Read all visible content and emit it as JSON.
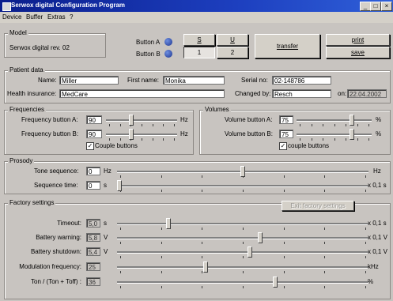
{
  "window": {
    "title": "Serwox digital Configuration Program",
    "min": "_",
    "max": "□",
    "close": "×"
  },
  "menu": [
    "Device",
    "Buffer",
    "Extras",
    "?"
  ],
  "model": {
    "title": "Model",
    "value": "Serwox digital rev. 02"
  },
  "buttons": {
    "a_label": "Button A",
    "b_label": "Button B",
    "s": "S",
    "u": "U",
    "one": "1",
    "two": "2",
    "transfer": "transfer",
    "print": "print",
    "save": "save"
  },
  "patient": {
    "title": "Patient data",
    "name_label": "Name:",
    "name": "Miller",
    "first_label": "First name:",
    "first": "Monika",
    "serial_label": "Serial no:",
    "serial": "02-148786",
    "insurance_label": "Health insurance:",
    "insurance": "MedCare",
    "changed_label": "Changed by:",
    "changed": "Resch",
    "on_label": "on:",
    "on": "22.04.2002"
  },
  "frequencies": {
    "title": "Frequencies",
    "a_label": "Frequency button A:",
    "a_value": "90",
    "a_unit": "Hz",
    "a_level": 0.34,
    "b_label": "Frequency button B:",
    "b_value": "90",
    "b_unit": "Hz",
    "b_level": 0.34,
    "couple": "Couple buttons"
  },
  "volumes": {
    "title": "Volumes",
    "a_label": "Volume button A:",
    "a_value": "75",
    "a_unit": "%",
    "a_level": 0.75,
    "b_label": "Volume button B:",
    "b_value": "75",
    "b_unit": "%",
    "b_level": 0.75,
    "couple": "couple buttons"
  },
  "prosody": {
    "title": "Prosody",
    "tone_label": "Tone sequence:",
    "tone_value": "0",
    "tone_unit": "Hz",
    "tone_unit_right": "Hz",
    "tone_level": 0.5,
    "seq_label": "Sequence time:",
    "seq_value": "0",
    "seq_unit": "s",
    "seq_unit_right": "x 0,1 s",
    "seq_level": 0.0
  },
  "factory": {
    "title": "Factory settings",
    "exit": "Exit factory settings",
    "rows": [
      {
        "label": "Timeout:",
        "value": "5,0",
        "unit": "s",
        "right": "x 0,1 s",
        "level": 0.2
      },
      {
        "label": "Battery warning:",
        "value": "5,8",
        "unit": "V",
        "right": "x 0,1 V",
        "level": 0.57
      },
      {
        "label": "Battery shutdown:",
        "value": "5,4",
        "unit": "V",
        "right": "x 0,1 V",
        "level": 0.53
      },
      {
        "label": "Modulation frequency:",
        "value": "25",
        "unit": "",
        "right": "kHz",
        "level": 0.35
      },
      {
        "label": "Ton / (Ton + Toff) :",
        "value": "36",
        "unit": "",
        "right": "%",
        "level": 0.63
      }
    ]
  }
}
